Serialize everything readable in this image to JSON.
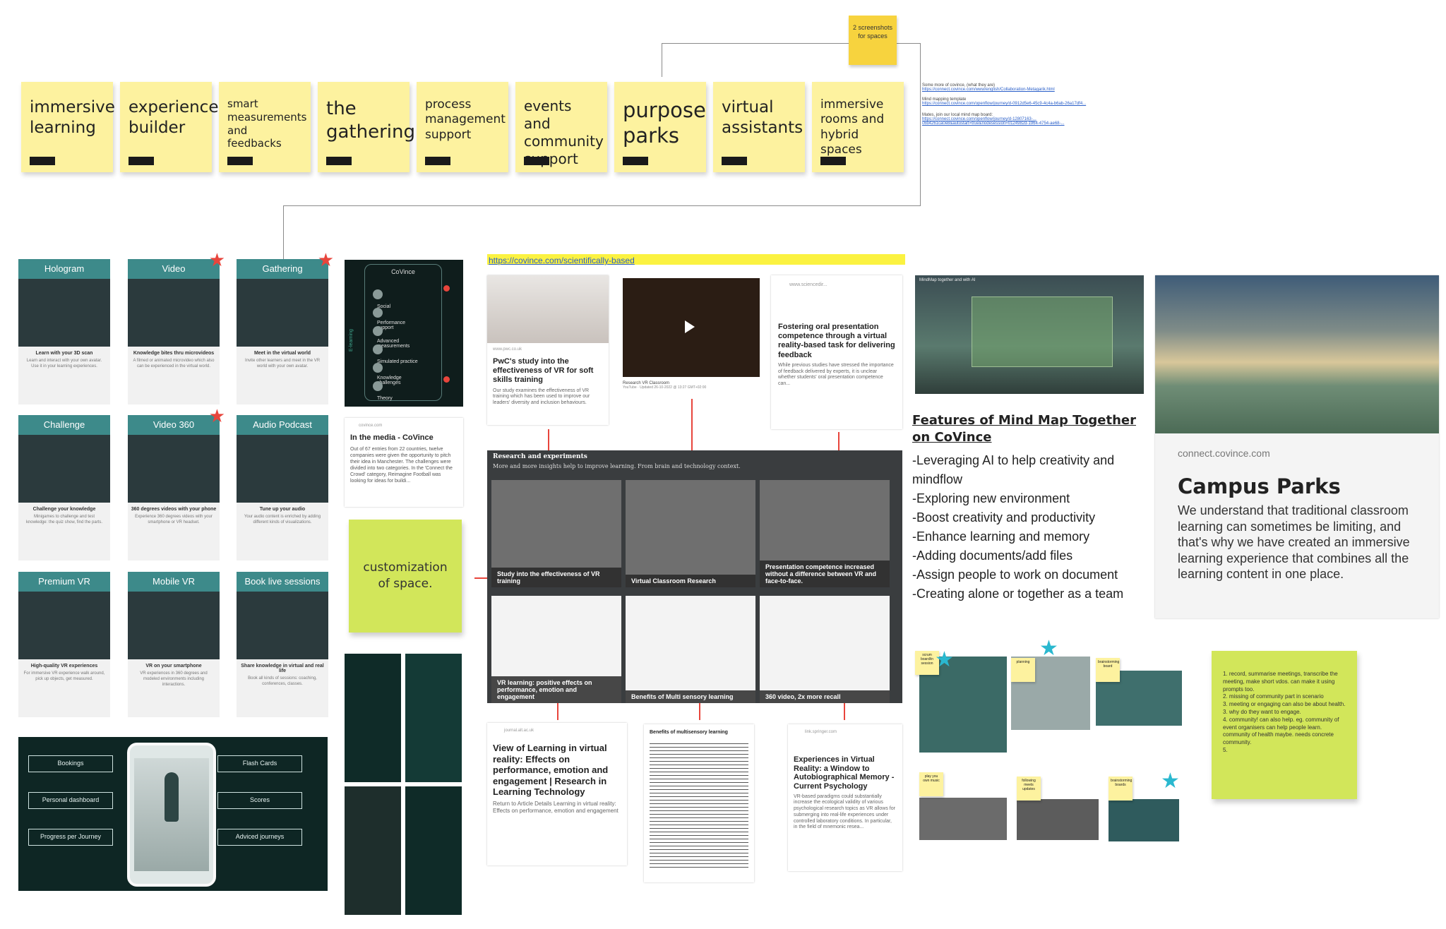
{
  "top_note": {
    "text": "2 screenshots for spaces"
  },
  "stickies": [
    {
      "text": "immersive learning",
      "size": 23
    },
    {
      "text": "experience builder",
      "size": 23
    },
    {
      "text": "smart measurements and feedbacks",
      "size": 15
    },
    {
      "text": "the gathering",
      "size": 26
    },
    {
      "text": "process management support",
      "size": 17
    },
    {
      "text": "events and community support",
      "size": 20
    },
    {
      "text": "purpose parks",
      "size": 29
    },
    {
      "text": "virtual assistants",
      "size": 23
    },
    {
      "text": "immersive rooms and hybrid spaces",
      "size": 17
    }
  ],
  "links_note": {
    "l1": "Some more of covince, (what they are)",
    "l2": "https://connect.covince.com/www/english/Collaboration-Metagarik.html",
    "l3": "Mind mapping template",
    "l4": "https://connect.covince.com/openflow/journey/d-0912d5e6-45c9-4c4a-b6ab-26a17df4...",
    "l5": "Mates, join our local mind map board:",
    "l6": "https://connect.covince.com/openflow/journey/d-12807163-...",
    "l7": "c6b4261ca0e8&autostart=true&nodesession=0124982d-1964-4754-ae68-..."
  },
  "cards": [
    {
      "title": "Hologram",
      "cap": "Learn with your 3D scan",
      "desc": "Learn and interact with your own avatar. Use it in your learning experiences.",
      "star": false
    },
    {
      "title": "Video",
      "cap": "Knowledge bites thru microvideos",
      "desc": "A filmed or animated microvideo which also can be experienced in the virtual world.",
      "star": true
    },
    {
      "title": "Gathering",
      "cap": "Meet in the virtual world",
      "desc": "Invite other learners and meet in the VR world with your own avatar.",
      "star": true
    },
    {
      "title": "Challenge",
      "cap": "Challenge your knowledge",
      "desc": "Minigames to challenge and test knowledge: the quiz show, find the parts.",
      "star": false
    },
    {
      "title": "Video 360",
      "cap": "360 degrees videos with your phone",
      "desc": "Experience 360 degrees videos with your smartphone or VR headset.",
      "star": true
    },
    {
      "title": "Audio Podcast",
      "cap": "Tune up your audio",
      "desc": "Your audio content is enriched by adding different kinds of visualizations.",
      "star": false
    },
    {
      "title": "Premium VR",
      "cap": "High-quality VR experiences",
      "desc": "For immersive VR experience walk around, pick up objects, get measured.",
      "star": false
    },
    {
      "title": "Mobile VR",
      "cap": "VR on your smartphone",
      "desc": "VR experiences in 360 degrees and modeled environments including interactions.",
      "star": false
    },
    {
      "title": "Book live sessions",
      "cap": "Share knowledge in virtual and real life",
      "desc": "Book all kinds of sessions: coaching, conferences, classes.",
      "star": false
    }
  ],
  "app_screen": {
    "logo": "CoVince",
    "menu": [
      "Social",
      "Performance support",
      "Advanced measurements",
      "Simulated practice",
      "Knowledge challenges",
      "Theory"
    ],
    "side_label": "E-learning"
  },
  "dashboard": {
    "left": [
      "Bookings",
      "Personal dashboard",
      "Progress per Journey"
    ],
    "right": [
      "Flash Cards",
      "Scores",
      "Adviced journeys"
    ]
  },
  "media_card": {
    "source": "covince.com",
    "title": "In the media - CoVince",
    "body": "Out of 67 entries from 22 countries, twelve companies were given the opportunity to pitch their idea in Manchester. The challenges were divided into two categories. In the 'Connect the Crowd' category, Reimagine Football was looking for ideas for buildi..."
  },
  "customization": {
    "text": "customization of space."
  },
  "url_bar": {
    "text": "https://covince.com/scientifically-based"
  },
  "pwc": {
    "source": "www.pwc.co.uk",
    "title": "PwC's study into the effectiveness of VR for soft skills training",
    "body": "Our study examines the effectiveness of VR training which has been used to improve our leaders' diversity and inclusion behaviours."
  },
  "youtube": {
    "title": "Research VR Classroom",
    "meta": "YouTube · Updated 26-10-2022 @ 13:27 GMT+02:00"
  },
  "sciencedirect": {
    "source": "www.sciencedir...",
    "title": "Fostering oral presentation competence through a virtual reality-based task for delivering feedback",
    "body": "While previous studies have stressed the importance of feedback delivered by experts, it is unclear whether students' oral presentation competence can..."
  },
  "research": {
    "title": "Research and experiments",
    "subtitle": "More and more insights help to improve learning. From brain and technology context.",
    "tiles": [
      "Study into the effectiveness of VR training",
      "Virtual Classroom Research",
      "Presentation competence increased without a difference between VR and face-to-face.",
      "VR learning: positive effects on performance, emotion and engagement",
      "Benefits of Multi sensory learning",
      "360 video, 2x more recall"
    ]
  },
  "alt_ac": {
    "source": "journal.alt.ac.uk",
    "title": "View of Learning in virtual reality: Effects on performance, emotion and engagement | Research in Learning Technology",
    "body": "Return to Article Details Learning in virtual reality: Effects on performance, emotion and engagement"
  },
  "multisensory": {
    "title": "Benefits of multisensory learning"
  },
  "springer": {
    "source": "link.springer.com",
    "title": "Experiences in Virtual Reality: a Window to Autobiographical Memory - Current Psychology",
    "body": "VR-based paradigms could substantially increase the ecological validity of various psychological research topics as VR allows for submerging into real-life experiences under controlled laboratory conditions. In particular, in the field of mnemonic resea..."
  },
  "mindmap_shot": {
    "label": "MindMap together and with AI"
  },
  "features": {
    "title": "Features of Mind Map Together on CoVince",
    "items": [
      "-Leveraging AI to help creativity and mindflow",
      "-Exploring new environment",
      "-Boost creativity and productivity",
      "-Enhance learning and memory",
      "-Adding documents/add files",
      "-Assign people to work on document",
      "-Creating alone or together as a team"
    ]
  },
  "campus": {
    "domain": "connect.covince.com",
    "title": "Campus Parks",
    "body": "We understand that traditional classroom learning can sometimes be limiting, and that's why we have created an immersive learning experience that combines all the learning content in one place."
  },
  "mini_notes": [
    "scrum board/in session",
    "planning",
    "brainstorming board",
    "play you own music",
    "following meets updates",
    "brainstorming boards"
  ],
  "green_note": {
    "lines": [
      "1. record, summarise meetings, transcribe the meeting, make short vdos. can make it using prompts too.",
      "2. missing of community part in scenario",
      "3. meeting or engaging can also be about health.",
      "3. why do they want to engage.",
      "4. community! can also help. eg. community of event organisers can help people learn. community of health maybe. needs concrete community.",
      "5."
    ]
  },
  "colors": {
    "sticky": "#fdf29f",
    "teal": "#3d8a8a",
    "red": "#e8453c",
    "green_note": "#d2e65a",
    "star_teal": "#2ab8cf"
  }
}
